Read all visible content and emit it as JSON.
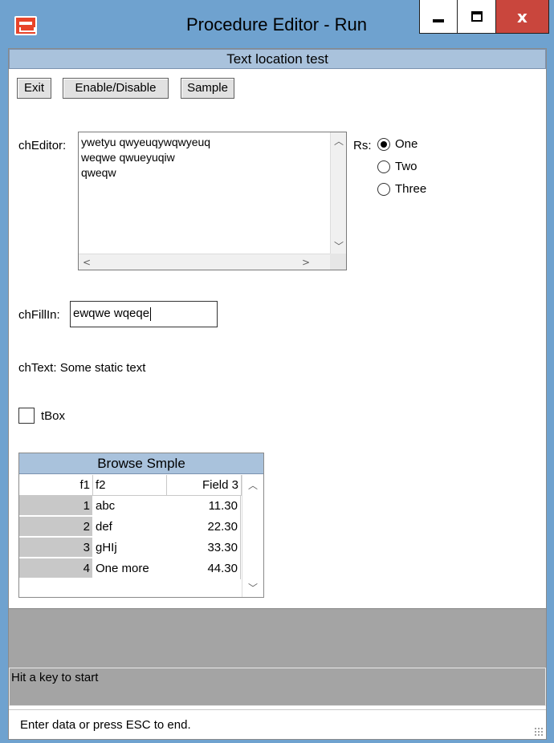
{
  "window": {
    "title": "Procedure Editor - Run",
    "min_icon": "minimize-icon",
    "max_icon": "maximize-icon",
    "close_label": "x"
  },
  "frame": {
    "title": "Text location test"
  },
  "toolbar": {
    "exit_label": "Exit",
    "enable_label": "Enable/Disable",
    "sample_label": "Sample"
  },
  "editor": {
    "label": "chEditor:",
    "value": "ywetyu qwyeuqywqwyeuq\nweqwe qwueyuqiw\nqweqw"
  },
  "radio": {
    "label": "Rs:",
    "options": [
      {
        "label": "One",
        "selected": true
      },
      {
        "label": "Two",
        "selected": false
      },
      {
        "label": "Three",
        "selected": false
      }
    ]
  },
  "fillin": {
    "label": "chFillIn:",
    "value": "ewqwe wqeqe"
  },
  "text": {
    "label": "chText:",
    "value": "Some static text"
  },
  "checkbox": {
    "label": "tBox",
    "checked": false
  },
  "browse": {
    "title": "Browse Smple",
    "columns": [
      "f1",
      "f2",
      "Field 3"
    ],
    "rows": [
      {
        "f1": "1",
        "f2": "abc",
        "f3": "11.30"
      },
      {
        "f1": "2",
        "f2": "def",
        "f3": "22.30"
      },
      {
        "f1": "3",
        "f2": "gHIj",
        "f3": "33.30"
      },
      {
        "f1": "4",
        "f2": "One more",
        "f3": "44.30"
      }
    ]
  },
  "message": {
    "text": "Hit a key to start"
  },
  "status": {
    "text": "Enter data or press ESC to end."
  },
  "colors": {
    "titlebar": "#6fa2cf",
    "close_button": "#c9463d",
    "frame_title": "#a9c2dc",
    "message_area": "#a4a4a4"
  }
}
